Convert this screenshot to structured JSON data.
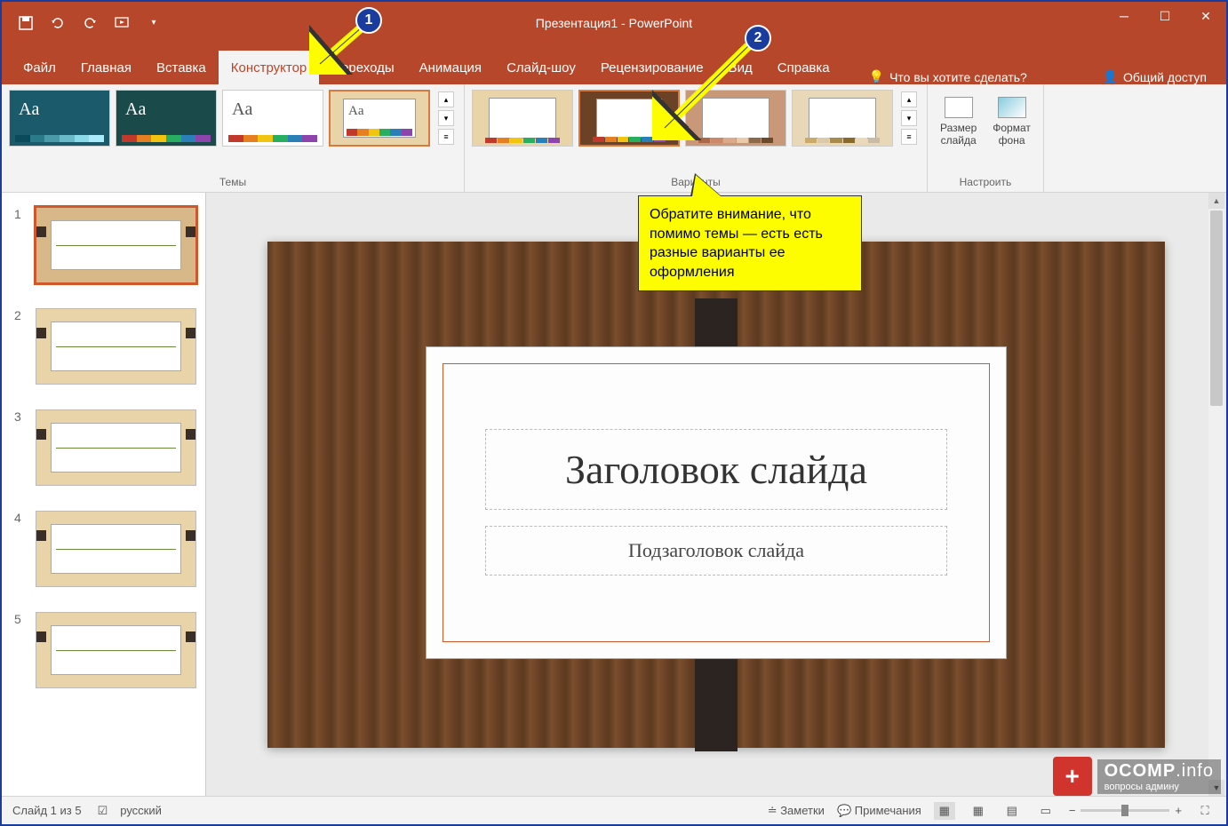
{
  "titlebar": {
    "title": "Презентация1 - PowerPoint"
  },
  "tabs": {
    "file": "Файл",
    "home": "Главная",
    "insert": "Вставка",
    "design": "Конструктор",
    "transitions": "Переходы",
    "animations": "Анимация",
    "slideshow": "Слайд-шоу",
    "review": "Рецензирование",
    "view": "Вид",
    "help": "Справка",
    "tellme": "Что вы хотите сделать?",
    "share": "Общий доступ"
  },
  "ribbon": {
    "themes_label": "Темы",
    "variants_label": "Варианты",
    "customize_label": "Настроить",
    "slide_size": "Размер\nслайда",
    "format_bg": "Формат\nфона"
  },
  "slide": {
    "title": "Заголовок слайда",
    "subtitle": "Подзаголовок слайда"
  },
  "slides": {
    "count": 5,
    "numbers": [
      "1",
      "2",
      "3",
      "4",
      "5"
    ]
  },
  "status": {
    "slide_counter": "Слайд 1 из 5",
    "language": "русский",
    "notes": "Заметки",
    "comments": "Примечания"
  },
  "annotations": {
    "badge1": "1",
    "badge2": "2",
    "callout": "Обратите внимание, что помимо темы — есть есть разные варианты ее оформления"
  },
  "watermark": {
    "brand": "OCOMP",
    "suffix": ".info",
    "sub": "вопросы админу"
  }
}
